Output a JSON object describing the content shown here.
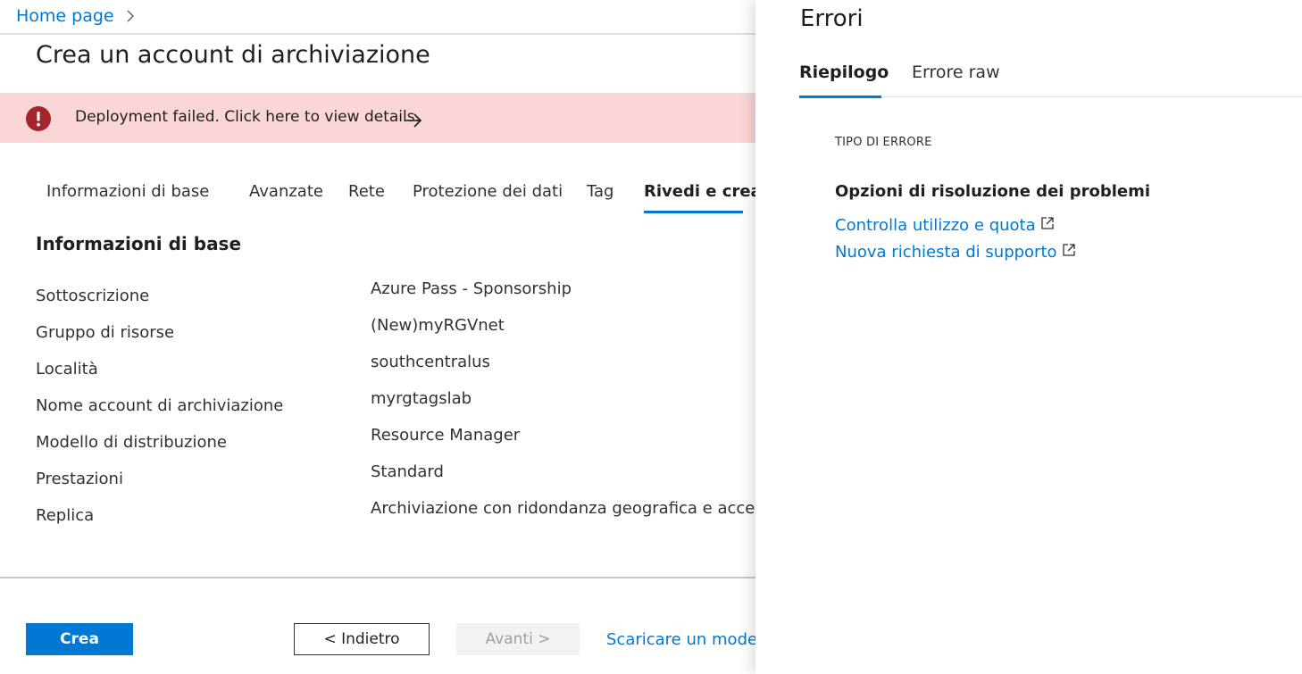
{
  "breadcrumb": {
    "home_label": "Home page"
  },
  "page": {
    "title": "Crea un account di archiviazione"
  },
  "banner": {
    "message": "Deployment failed. Click here to view details.",
    "color": "#fbd6d8",
    "icon_color": "#a4262c"
  },
  "tabs": [
    {
      "label": "Informazioni di base"
    },
    {
      "label": "Avanzate"
    },
    {
      "label": "Rete"
    },
    {
      "label": "Protezione dei dati"
    },
    {
      "label": "Tag"
    },
    {
      "label": "Rivedi e crea"
    }
  ],
  "active_tab": "Rivedi e crea",
  "summary": {
    "section_title": "Informazioni di base",
    "rows": [
      {
        "label": "Sottoscrizione",
        "value": "Azure Pass - Sponsorship"
      },
      {
        "label": "Gruppo di risorse",
        "value": "(New)myRGVnet"
      },
      {
        "label": "Località",
        "value": "southcentralus"
      },
      {
        "label": "Nome account di archiviazione",
        "value": "myrgtagslab"
      },
      {
        "label": "Modello di distribuzione",
        "value": "Resource Manager"
      },
      {
        "label": "Prestazioni",
        "value": "Standard"
      },
      {
        "label": "Replica",
        "value": "Archiviazione con ridondanza geografica e accesso"
      }
    ]
  },
  "footer": {
    "create_label": "Crea",
    "back_label": "< Indietro",
    "next_label": "Avanti >",
    "download_label": "Scaricare un modell"
  },
  "error_panel": {
    "title": "Errori",
    "tabs": [
      {
        "label": "Riepilogo"
      },
      {
        "label": "Errore raw"
      }
    ],
    "error_type_label": "TIPO DI ERRORE",
    "troubleshoot_heading": "Opzioni di risoluzione dei problemi",
    "links": [
      {
        "label": "Controlla utilizzo e quota"
      },
      {
        "label": "Nuova richiesta di supporto"
      }
    ]
  },
  "colors": {
    "accent": "#0078d4"
  }
}
